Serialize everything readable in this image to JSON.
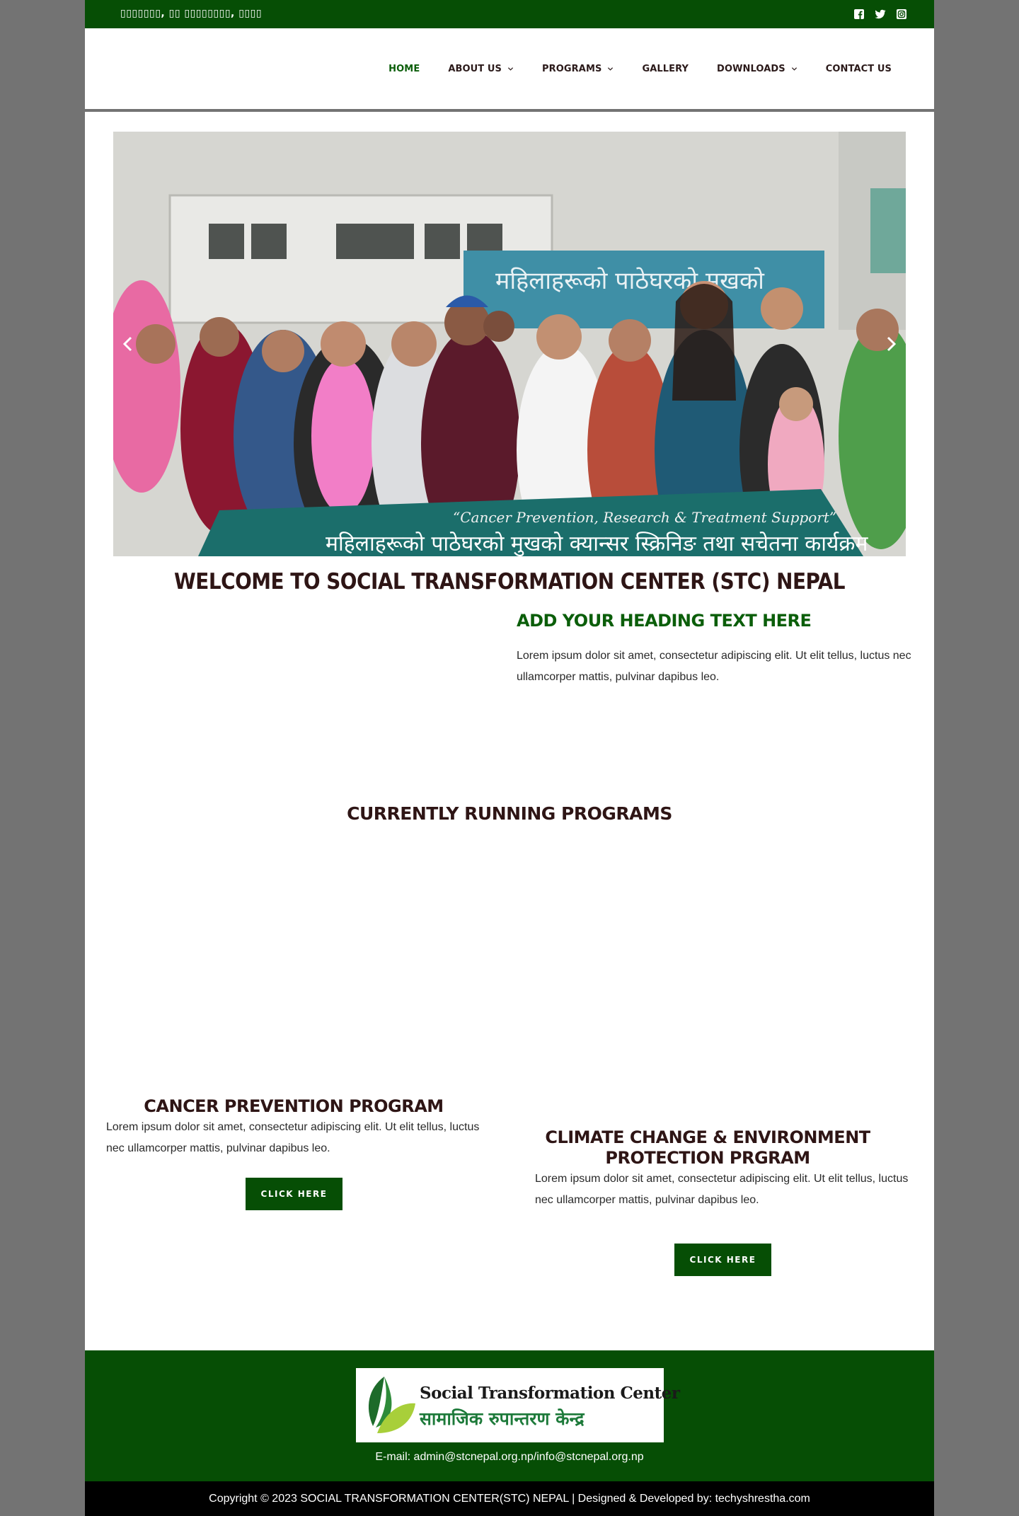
{
  "topbar": {
    "address": "▯▯▯▯▯▯▯, ▯▯ ▯▯▯▯▯▯▯▯, ▯▯▯▯",
    "social": [
      "facebook-icon",
      "twitter-icon",
      "instagram-icon"
    ]
  },
  "nav": {
    "items": [
      {
        "label": "HOME",
        "active": true,
        "dropdown": false
      },
      {
        "label": "ABOUT US",
        "active": false,
        "dropdown": true
      },
      {
        "label": "PROGRAMS",
        "active": false,
        "dropdown": true
      },
      {
        "label": "GALLERY",
        "active": false,
        "dropdown": false
      },
      {
        "label": "DOWNLOADS",
        "active": false,
        "dropdown": true
      },
      {
        "label": "CONTACT US",
        "active": false,
        "dropdown": false
      }
    ]
  },
  "hero": {
    "banner_top_text": "महिलाहरूको पाठेघरको मुखको",
    "banner_bottom_caption": "“Cancer Prevention, Research & Treatment Support”",
    "banner_bottom_text": "महिलाहरूको पाठेघरको मुखको क्यान्सर स्क्रिनिङ तथा सचेतना कार्यक्रम"
  },
  "welcome": {
    "title": "WELCOME TO SOCIAL TRANSFORMATION CENTER (STC) NEPAL",
    "sub_heading": "ADD YOUR HEADING TEXT HERE",
    "text": "Lorem ipsum dolor sit amet, consectetur adipiscing elit. Ut elit tellus, luctus nec ullamcorper mattis, pulvinar dapibus leo."
  },
  "programs": {
    "heading": "CURRENTLY RUNNING PROGRAMS",
    "items": [
      {
        "title": "CANCER PREVENTION PROGRAM",
        "text": "Lorem ipsum dolor sit amet, consectetur adipiscing elit. Ut elit tellus, luctus nec ullamcorper mattis, pulvinar dapibus leo.",
        "button": "CLICK HERE"
      },
      {
        "title": "CLIMATE CHANGE & ENVIRONMENT PROTECTION PRGRAM",
        "text": "Lorem ipsum dolor sit amet, consectetur adipiscing elit. Ut elit tellus, luctus nec ullamcorper mattis, pulvinar dapibus leo.",
        "button": "CLICK HERE"
      }
    ]
  },
  "footer": {
    "logo_en": "Social Transformation Center",
    "logo_np": "सामाजिक रुपान्तरण केन्द्र",
    "email": "E-mail: admin@stcnepal.org.np/info@stcnepal.org.np",
    "copyright": "Copyright © 2023 SOCIAL TRANSFORMATION CENTER(STC) NEPAL | Designed & Developed by: techyshrestha.com"
  },
  "colors": {
    "brand_green": "#064e05",
    "active_nav": "#0b5e0a",
    "heading_dark": "#2e1515",
    "page_bg": "#737373"
  }
}
